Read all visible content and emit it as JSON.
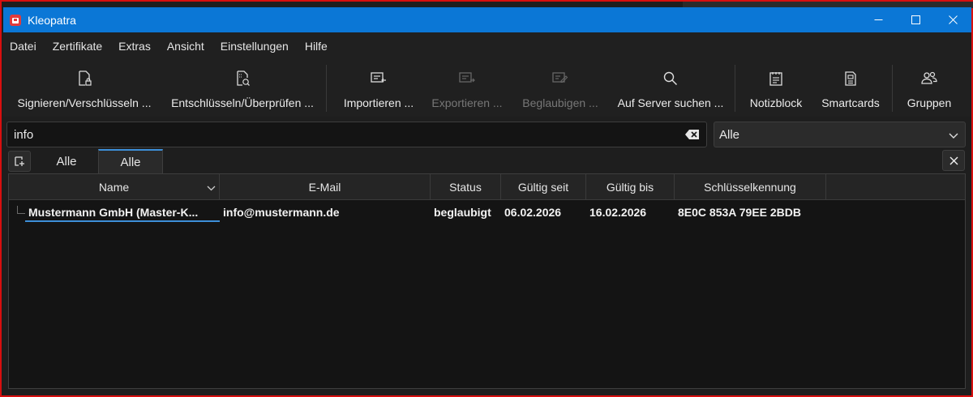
{
  "window": {
    "title": "Kleopatra"
  },
  "menu": [
    "Datei",
    "Zertifikate",
    "Extras",
    "Ansicht",
    "Einstellungen",
    "Hilfe"
  ],
  "toolbar": {
    "sign": {
      "label": "Signieren/Verschlüsseln ...",
      "icon": "sign-encrypt-icon"
    },
    "decrypt": {
      "label": "Entschlüsseln/Überprüfen ...",
      "icon": "decrypt-verify-icon"
    },
    "import": {
      "label": "Importieren ...",
      "icon": "import-icon"
    },
    "export": {
      "label": "Exportieren ...",
      "icon": "export-icon"
    },
    "certify": {
      "label": "Beglaubigen ...",
      "icon": "certify-icon"
    },
    "lookup": {
      "label": "Auf Server suchen ...",
      "icon": "search-icon"
    },
    "notepad": {
      "label": "Notizblock",
      "icon": "notepad-icon"
    },
    "smartcards": {
      "label": "Smartcards",
      "icon": "smartcard-icon"
    },
    "groups": {
      "label": "Gruppen",
      "icon": "groups-icon"
    }
  },
  "search": {
    "value": "info"
  },
  "filter": {
    "selected": "Alle"
  },
  "tabs": [
    {
      "label": "Alle"
    },
    {
      "label": "Alle"
    }
  ],
  "table": {
    "columns": [
      "Name",
      "E-Mail",
      "Status",
      "Gültig seit",
      "Gültig bis",
      "Schlüsselkennung"
    ],
    "rows": [
      {
        "name": "Mustermann GmbH (Master-K...",
        "email": "info@mustermann.de",
        "status": "beglaubigt",
        "valid_from": "06.02.2026",
        "valid_until": "16.02.2026",
        "key_id": "8E0C 853A 79EE 2BDB"
      }
    ]
  },
  "colors": {
    "titlebar": "#0b77d6",
    "accent": "#3d8fd9",
    "frame": "#d80f0f"
  }
}
